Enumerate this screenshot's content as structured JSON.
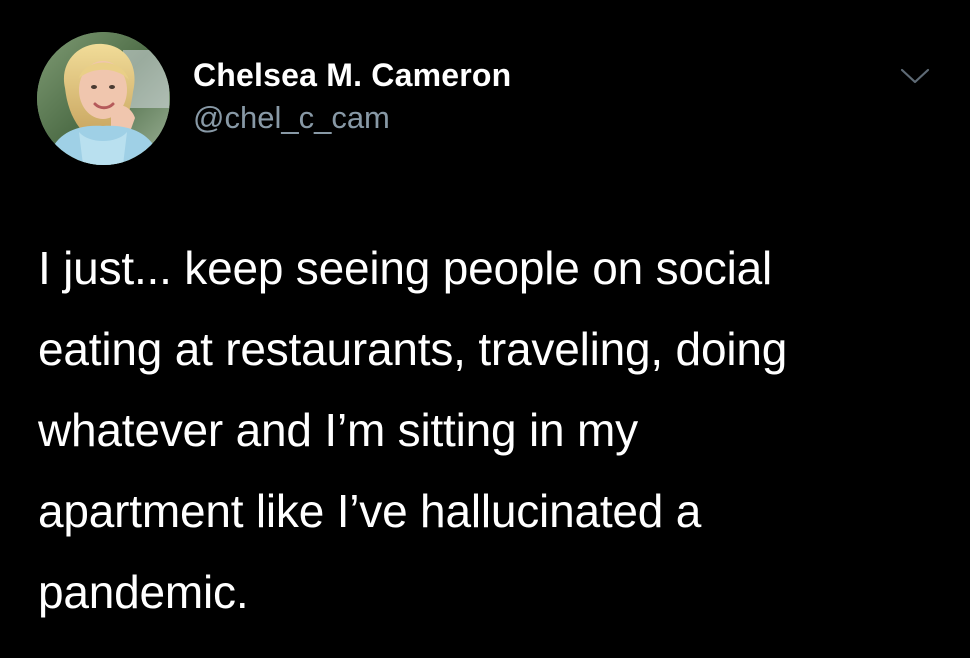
{
  "tweet": {
    "author": {
      "display_name": "Chelsea M. Cameron",
      "handle": "@chel_c_cam",
      "avatar_icon": "profile-photo"
    },
    "menu_icon": "chevron-down-icon",
    "text": "I just... keep seeing people on social\neating at restaurants, traveling, doing\nwhatever and I’m sitting in my\napartment like I’ve hallucinated a\npandemic."
  },
  "colors": {
    "background": "#000000",
    "primary_text": "#ffffff",
    "secondary_text": "#8899a6"
  }
}
